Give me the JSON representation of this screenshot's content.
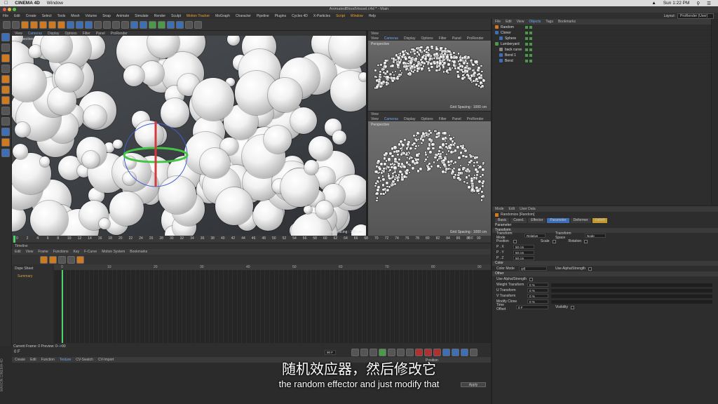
{
  "mac_menu": {
    "app": "CINEMA 4D",
    "window": "Window",
    "time": "Sun 1:22 PM"
  },
  "window_title": "AnimatedBloodVessel.c4d * - Main",
  "layout": {
    "label": "Layout:",
    "value": "ProRender (User)"
  },
  "main_menu": [
    "File",
    "Edit",
    "Create",
    "Select",
    "Tools",
    "Mesh",
    "Volume",
    "Snap",
    "Animate",
    "Simulate",
    "Render",
    "Sculpt",
    "Motion Tracker",
    "MoGraph",
    "Character",
    "Pipeline",
    "Plugins",
    "Cycles 4D",
    "X-Particles",
    "Script",
    "Window",
    "Help"
  ],
  "viewport_menu": [
    "View",
    "Cameras",
    "Display",
    "Options",
    "Filter",
    "Panel",
    "ProRender"
  ],
  "viewport_main": {
    "label": "Perspective",
    "grid": "Grid Spacing : 100 cm"
  },
  "viewport_tr": {
    "title": "View",
    "label": "Perspective",
    "grid": "Grid Spacing : 1000 cm"
  },
  "viewport_br": {
    "title": "View",
    "label": "Perspective",
    "grid": "Grid Spacing : 1000 cm"
  },
  "objects_menu": [
    "File",
    "Edit",
    "View",
    "Objects",
    "Tags",
    "Bookmarks"
  ],
  "objects": [
    {
      "name": "Random",
      "color": "#d07a20"
    },
    {
      "name": "Cloner",
      "color": "#3d6fb8"
    },
    {
      "name": "Sphere",
      "color": "#3d6fb8"
    },
    {
      "name": "Lumberyard",
      "color": "#4a9a4a"
    },
    {
      "name": "back curve",
      "color": "#888888"
    },
    {
      "name": "Bend 1",
      "color": "#3d6fb8"
    },
    {
      "name": "Bend",
      "color": "#3d6fb8"
    }
  ],
  "ruler_ticks": [
    "0",
    "2",
    "4",
    "6",
    "8",
    "10",
    "12",
    "14",
    "16",
    "18",
    "20",
    "22",
    "24",
    "26",
    "28",
    "30",
    "32",
    "34",
    "36",
    "38",
    "40",
    "42",
    "44",
    "46",
    "48",
    "50",
    "52",
    "54",
    "56",
    "58",
    "60",
    "62",
    "64",
    "66",
    "68",
    "70",
    "72",
    "74",
    "76",
    "78",
    "80",
    "82",
    "84",
    "86",
    "88",
    "90"
  ],
  "ruler_end": "0 F",
  "timeline_title": "Timeline",
  "timeline_menu": [
    "Edit",
    "View",
    "Frame",
    "Functions",
    "Key",
    "F-Curve",
    "Motion System",
    "Bookmarks"
  ],
  "dopesheet": {
    "title": "Dope Sheet",
    "summary": "Summary",
    "ticks": [
      "0",
      "10",
      "20",
      "30",
      "40",
      "50",
      "60",
      "70",
      "80",
      "90"
    ]
  },
  "current_frame": "Current Frame: 0  Preview: 0-->90",
  "frame_field": "0 F",
  "frame_end": "90 F",
  "materials_menu": [
    "Create",
    "Edit",
    "Function",
    "Texture",
    "CV-Swatch",
    "CV-Import"
  ],
  "attr_menu": [
    "Mode",
    "Edit",
    "User Data"
  ],
  "attr_title": "Randomize [Random]",
  "attr_tabs": [
    "Basic",
    "Coord.",
    "Effector",
    "Parameter",
    "Deformer",
    "Falloff"
  ],
  "parameter_label": "Parameter",
  "transform": {
    "section": "Transform",
    "mode_label": "Transform Mode",
    "mode_value": "Relative",
    "space_label": "Transform Space",
    "space_value": "Node",
    "position_label": "Position",
    "scale_label": "Scale",
    "rotation_label": "Rotation",
    "px_label": "P . X",
    "px_value": "50 cm",
    "py_label": "P . Y",
    "py_value": "50 cm",
    "pz_label": "P . Z",
    "pz_value": "50 cm"
  },
  "color": {
    "section": "Color",
    "mode_label": "Color Mode",
    "mode_value": "Off",
    "alpha_label": "Use Alpha/Strength"
  },
  "other": {
    "section": "Other",
    "use_alpha": "Use Alpha/Strength",
    "weight_label": "Weight Transform",
    "weight_value": "0 %",
    "u_label": "U Transform",
    "u_value": "0 %",
    "v_label": "V Transform",
    "v_value": "0 %",
    "clone_label": "Modify Clone",
    "clone_value": "0 %",
    "time_label": "Time Offset",
    "time_value": "0 F",
    "visibility_label": "Visibility"
  },
  "coord_label": "Position",
  "apply_button": "Apply",
  "subtitle": {
    "chinese": "随机效应器，然后修改它",
    "english": "the random effector and just modify that"
  }
}
